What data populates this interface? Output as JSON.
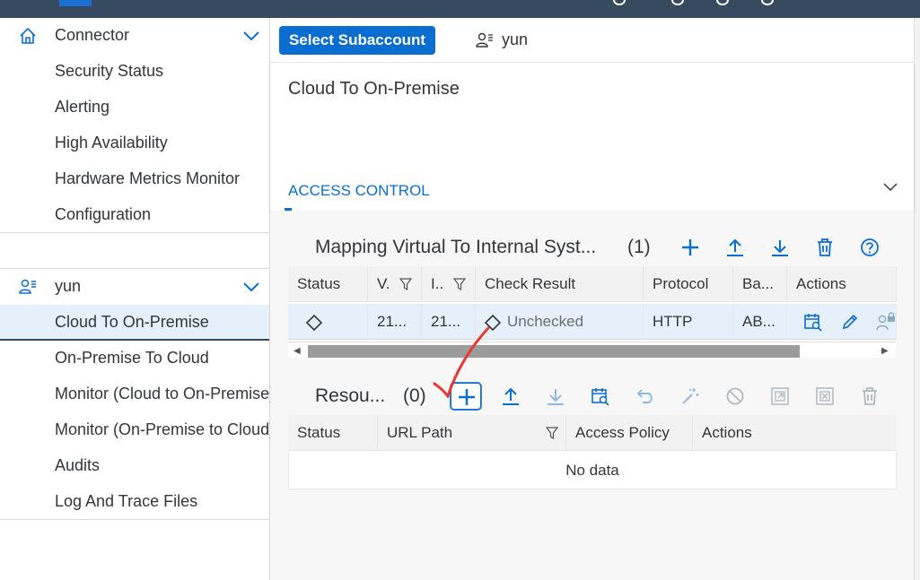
{
  "colors": {
    "accent": "#0a6ed1",
    "shell": "#354a5f",
    "selected_row": "#e5f0fa",
    "disabled": "#b0b8c0",
    "annotation": "#e53935"
  },
  "sidebar": {
    "connector_group": {
      "label": "Connector",
      "icon": "home-icon"
    },
    "connector_items": [
      {
        "label": "Security Status"
      },
      {
        "label": "Alerting"
      },
      {
        "label": "High Availability"
      },
      {
        "label": "Hardware Metrics Monitor"
      },
      {
        "label": "Configuration"
      }
    ],
    "subaccount_group": {
      "label": "yun",
      "icon": "user-list-icon"
    },
    "subaccount_items": [
      {
        "label": "Cloud To On-Premise",
        "active": true
      },
      {
        "label": "On-Premise To Cloud"
      },
      {
        "label": "Monitor (Cloud to On-Premise)"
      },
      {
        "label": "Monitor (On-Premise to Cloud)"
      },
      {
        "label": "Audits"
      },
      {
        "label": "Log And Trace Files"
      }
    ]
  },
  "topbar": {
    "select_button": "Select Subaccount",
    "user": "yun"
  },
  "header": {
    "title": "Cloud To On-Premise",
    "tab": "ACCESS CONTROL"
  },
  "mapping": {
    "title": "Mapping Virtual To Internal Syst...",
    "count": "(1)",
    "columns": [
      "Status",
      "V.",
      "I..",
      "Check Result",
      "Protocol",
      "Ba...",
      "Actions"
    ],
    "rows": [
      {
        "virtual": "21...",
        "internal": "21...",
        "check_result": "Unchecked",
        "protocol": "HTTP",
        "backend": "AB..."
      }
    ]
  },
  "resources": {
    "title": "Resou...",
    "count": "(0)",
    "columns": [
      "Status",
      "URL Path",
      "Access Policy",
      "Actions"
    ],
    "empty_text": "No data"
  }
}
